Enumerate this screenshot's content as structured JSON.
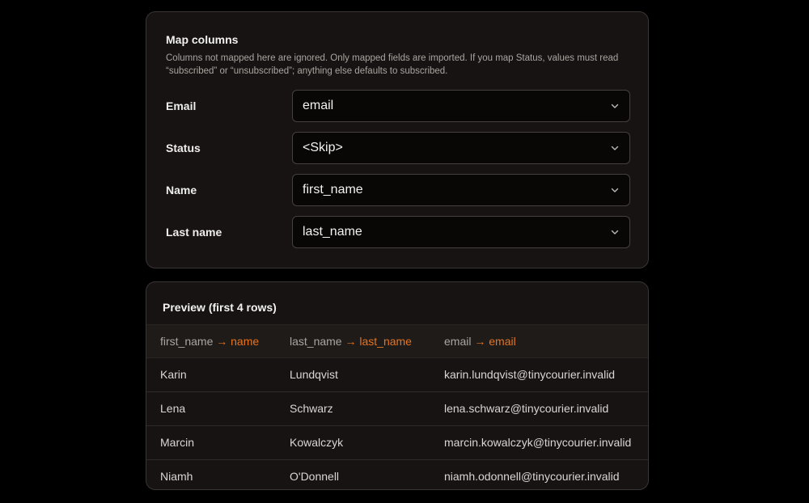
{
  "map_columns": {
    "title": "Map columns",
    "description": "Columns not mapped here are ignored. Only mapped fields are imported. If you map Status, values must read “subscribed” or “unsubscribed”; anything else defaults to subscribed.",
    "fields": [
      {
        "label": "Email",
        "value": "email"
      },
      {
        "label": "Status",
        "value": "<Skip>"
      },
      {
        "label": "Name",
        "value": "first_name"
      },
      {
        "label": "Last name",
        "value": "last_name"
      }
    ],
    "chevron_icon": "chevron-down-icon"
  },
  "preview": {
    "title": "Preview (first 4 rows)",
    "arrow": "→",
    "accent_color": "#e57320",
    "columns": [
      {
        "source": "first_name",
        "target": "name"
      },
      {
        "source": "last_name",
        "target": "last_name"
      },
      {
        "source": "email",
        "target": "email"
      }
    ],
    "rows": [
      [
        "Karin",
        "Lundqvist",
        "karin.lundqvist@tinycourier.invalid"
      ],
      [
        "Lena",
        "Schwarz",
        "lena.schwarz@tinycourier.invalid"
      ],
      [
        "Marcin",
        "Kowalczyk",
        "marcin.kowalczyk@tinycourier.invalid"
      ],
      [
        "Niamh",
        "O'Donnell",
        "niamh.odonnell@tinycourier.invalid"
      ]
    ]
  }
}
